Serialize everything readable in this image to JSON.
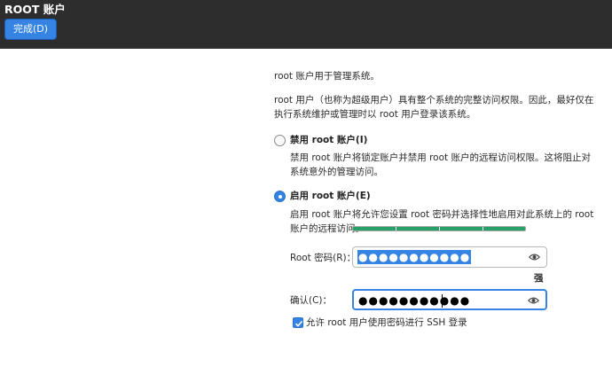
{
  "header": {
    "title": "ROOT 账户",
    "done_label": "完成(D)"
  },
  "intro": {
    "line1": "root 账户用于管理系统。",
    "desc_line1": "root 用户（也称为超级用户）具有整个系统的完整访问权限。因此，最好仅在",
    "desc_line2": "执行系统维护或管理时以 root 用户登录该系统。"
  },
  "disable_option": {
    "label": "禁用 root 账户(I)",
    "desc_line1": "禁用 root 账户将锁定账户并禁用 root 账户的远程访问权限。这将阻止对",
    "desc_line2": "系统意外的管理访问。",
    "checked": false
  },
  "enable_option": {
    "label": "启用 root 账户(E)",
    "desc_line1": "启用 root 账户将允许您设置 root 密码并选择性地启用对此系统上的 root",
    "desc_line2": "账户的远程访问。",
    "checked": true
  },
  "password": {
    "label": "Root 密码(R)：",
    "value": "●●●●●●●●●●●",
    "icon": "eye-icon"
  },
  "strength": {
    "level": 1.0,
    "label": "强",
    "color": "#26a269"
  },
  "confirm": {
    "label": "确认(C)：",
    "value": "●●●●●●●●●●●",
    "icon": "eye-icon"
  },
  "ssh": {
    "label": "允许 root 用户使用密码进行 SSH 登录",
    "checked": true
  },
  "colors": {
    "header_bg": "#2d2d2d",
    "accent": "#3584e4"
  }
}
